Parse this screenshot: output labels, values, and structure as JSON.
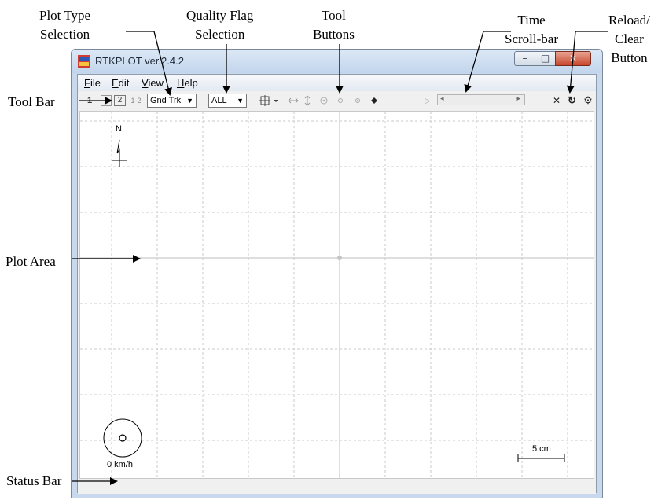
{
  "annotations": {
    "plot_type": [
      "Plot Type",
      "Selection"
    ],
    "quality_flag": [
      "Quality Flag",
      "Selection"
    ],
    "tool_buttons": [
      "Tool",
      "Buttons"
    ],
    "time_scroll": [
      "Time",
      "Scroll-bar"
    ],
    "reload_clear": [
      "Reload/",
      "Clear",
      "Button"
    ],
    "tool_bar": "Tool Bar",
    "plot_area": "Plot Area",
    "status_bar": "Status Bar"
  },
  "window": {
    "title": "RTKPLOT ver.2.4.2",
    "min_glyph": "–",
    "max_glyph": "□",
    "close_glyph": "✕"
  },
  "menu": [
    {
      "key": "F",
      "rest": "ile"
    },
    {
      "key": "E",
      "rest": "dit"
    },
    {
      "key": "V",
      "rest": "iew"
    },
    {
      "key": "H",
      "rest": "elp"
    }
  ],
  "toolbar": {
    "btn1": "1",
    "btn2": "2",
    "btn12": "1-2",
    "plot_type": "Gnd Trk",
    "quality": "ALL",
    "close_glyph": "✕",
    "reload_glyph": "↻",
    "options_glyph": "⚙"
  },
  "plot": {
    "north": "N",
    "speed": "0 km/h",
    "scale": "5 cm"
  },
  "colors": {
    "grid": "#c8c8c8",
    "axis": "#bdbdbd",
    "arrow": "#000000"
  }
}
